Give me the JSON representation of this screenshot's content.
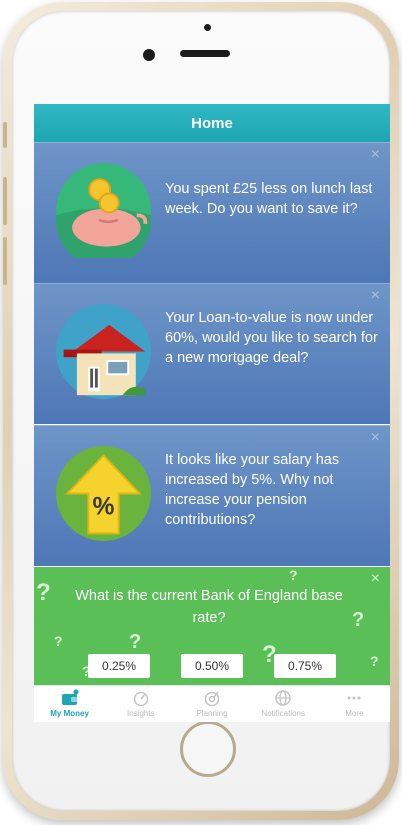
{
  "header": {
    "title": "Home"
  },
  "cards": [
    {
      "text": "You spent £25 less on lunch last week. Do you want to save it?",
      "icon": "piggy-bank-icon",
      "close": "×"
    },
    {
      "text": "Your Loan-to-value is now under 60%, would you like to search for a new mortgage deal?",
      "icon": "house-icon",
      "close": "×"
    },
    {
      "text": "It looks like your salary has increased by 5%. Why not increase your pension contributions?",
      "icon": "percent-up-arrow-icon",
      "close": "×"
    }
  ],
  "quiz": {
    "question": "What is the current Bank of England base rate?",
    "close": "×",
    "options": [
      "0.25%",
      "0.50%",
      "0.75%"
    ]
  },
  "tabs": [
    {
      "label": "My Money",
      "icon": "wallet-icon",
      "active": true
    },
    {
      "label": "Insights",
      "icon": "insights-icon",
      "active": false
    },
    {
      "label": "Planning",
      "icon": "planning-icon",
      "active": false
    },
    {
      "label": "Notifications",
      "icon": "globe-icon",
      "active": false
    },
    {
      "label": "More",
      "icon": "more-icon",
      "active": false
    }
  ],
  "colors": {
    "nav": "#1ea6b3",
    "card": "#5b83bf",
    "quiz": "#5bbf57",
    "active_tab": "#1ea6b3"
  }
}
